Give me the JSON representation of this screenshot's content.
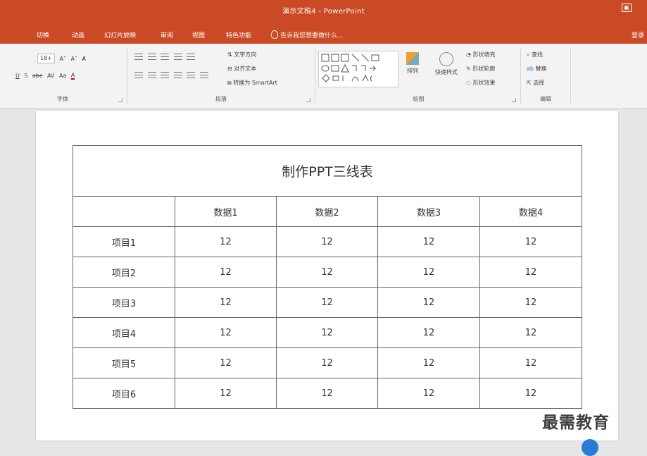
{
  "window": {
    "title": "演示文稿4 - PowerPoint",
    "restore_icon": "restore-icon"
  },
  "menu": {
    "items": [
      "切换",
      "动画",
      "幻灯片放映",
      "审阅",
      "视图",
      "特色功能"
    ],
    "search_hint": "告诉我您想要做什么...",
    "login": "登录"
  },
  "ribbon": {
    "font": {
      "size": "18+",
      "group_label": "字体",
      "btn_grow": "A˄",
      "btn_shrink": "A˅",
      "btn_clear": "A̸",
      "underline": "U",
      "strike": "S",
      "abc": "abc",
      "spacing": "AV",
      "case": "Aa",
      "color": "A"
    },
    "paragraph": {
      "group_label": "段落",
      "text_direction": "文字方向",
      "align_text": "对齐文本",
      "convert_smartart": "转换为 SmartArt"
    },
    "drawing": {
      "group_label": "绘图",
      "arrange": "排列",
      "quick_styles": "快速样式",
      "shape_fill": "形状填充",
      "shape_outline": "形状轮廓",
      "shape_effects": "形状效果"
    },
    "editing": {
      "group_label": "编辑",
      "find": "查找",
      "replace": "替换",
      "select": "选择"
    }
  },
  "slide": {
    "table": {
      "title": "制作PPT三线表",
      "headers": [
        "",
        "数据1",
        "数据2",
        "数据3",
        "数据4"
      ],
      "rows": [
        [
          "项目1",
          "12",
          "12",
          "12",
          "12"
        ],
        [
          "项目2",
          "12",
          "12",
          "12",
          "12"
        ],
        [
          "项目3",
          "12",
          "12",
          "12",
          "12"
        ],
        [
          "项目4",
          "12",
          "12",
          "12",
          "12"
        ],
        [
          "项目5",
          "12",
          "12",
          "12",
          "12"
        ],
        [
          "项目6",
          "12",
          "12",
          "12",
          "12"
        ]
      ]
    }
  },
  "watermark": "最需教育",
  "colors": {
    "accent": "#c94a25",
    "ribbon": "#f3f3f3",
    "canvas": "#e6e6e6"
  }
}
